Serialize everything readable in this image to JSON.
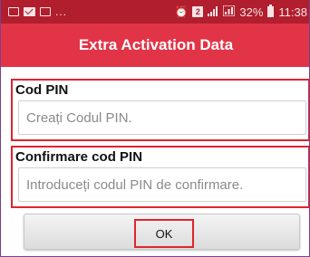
{
  "status_bar": {
    "left_dots": "...",
    "icons": [
      "image-icon",
      "mail-icon",
      "alarm-icon",
      "sim-2-icon",
      "signal-icon",
      "network-4g-icon",
      "battery-icon"
    ],
    "sim_label": "2",
    "battery_percent": "32%",
    "time": "11:38",
    "background_color": "#b11e2d"
  },
  "title_bar": {
    "title": "Extra Activation Data",
    "background_color": "#e23447"
  },
  "pin_field": {
    "label": "Cod PIN",
    "placeholder": "Creați Codul PIN.",
    "value": ""
  },
  "confirm_field": {
    "label": "Confirmare cod PIN",
    "placeholder": "Introduceți codul PIN de confirmare.",
    "value": ""
  },
  "ok_button": {
    "label": "OK"
  },
  "highlight_color": "#e0242e"
}
